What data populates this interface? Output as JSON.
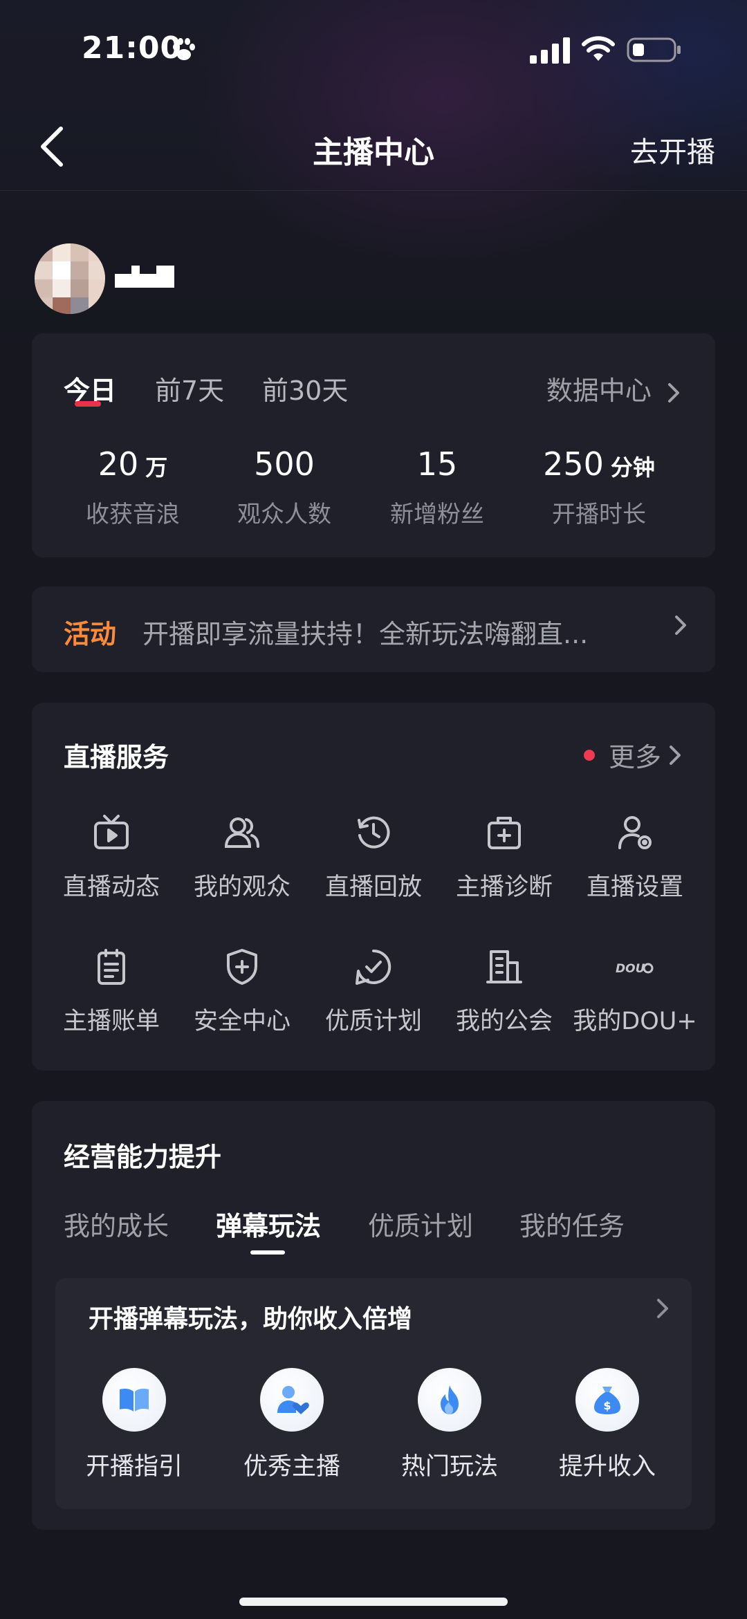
{
  "status_bar": {
    "time": "21:00"
  },
  "nav": {
    "title": "主播中心",
    "action": "去开播"
  },
  "stats": {
    "tabs": [
      "今日",
      "前7天",
      "前30天"
    ],
    "data_center": "数据中心",
    "items": [
      {
        "value": "20",
        "unit": "万",
        "label": "收获音浪"
      },
      {
        "value": "500",
        "unit": "",
        "label": "观众人数"
      },
      {
        "value": "15",
        "unit": "",
        "label": "新增粉丝"
      },
      {
        "value": "250",
        "unit": "分钟",
        "label": "开播时长"
      }
    ]
  },
  "activity": {
    "tag": "活动",
    "text": "开播即享流量扶持！全新玩法嗨翻直..."
  },
  "services": {
    "title": "直播服务",
    "more": "更多",
    "items": [
      {
        "label": "直播动态",
        "icon": "tv-icon"
      },
      {
        "label": "我的观众",
        "icon": "users-icon"
      },
      {
        "label": "直播回放",
        "icon": "history-icon"
      },
      {
        "label": "主播诊断",
        "icon": "medkit-icon"
      },
      {
        "label": "直播设置",
        "icon": "user-settings-icon"
      },
      {
        "label": "主播账单",
        "icon": "clipboard-icon"
      },
      {
        "label": "安全中心",
        "icon": "shield-icon"
      },
      {
        "label": "优质计划",
        "icon": "check-circle-icon"
      },
      {
        "label": "我的公会",
        "icon": "building-icon"
      },
      {
        "label": "我的DOU+",
        "icon": "dou-plus-icon",
        "logo_text": "DOU"
      }
    ]
  },
  "growth": {
    "title": "经营能力提升",
    "tabs": [
      "我的成长",
      "弹幕玩法",
      "优质计划",
      "我的任务"
    ],
    "active_tab": 1,
    "inner_title": "开播弹幕玩法，助你收入倍增",
    "features": [
      {
        "label": "开播指引",
        "icon": "book-icon"
      },
      {
        "label": "优秀主播",
        "icon": "user-heart-icon"
      },
      {
        "label": "热门玩法",
        "icon": "flame-icon"
      },
      {
        "label": "提升收入",
        "icon": "money-bag-icon"
      }
    ]
  },
  "colors": {
    "background": "#16171f",
    "card": "#1f2029",
    "accent_red": "#e8344a",
    "activity_orange": "#ff8b3a",
    "feature_blue": "#3d8bf2"
  }
}
